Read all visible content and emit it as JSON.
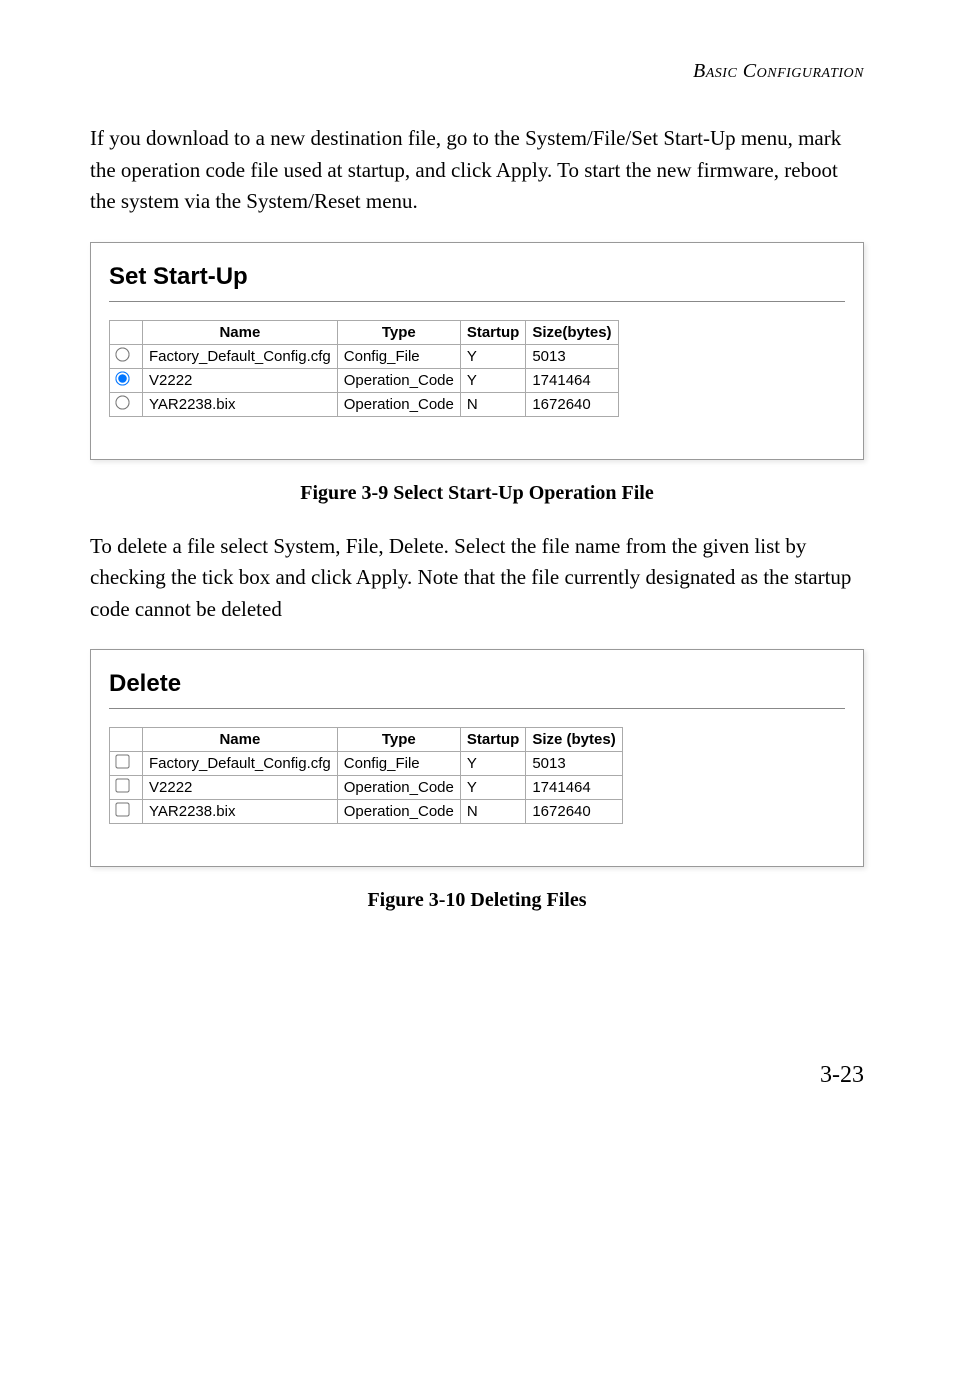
{
  "runningHeader": "Basic Configuration",
  "para1": "If you download to a new destination file, go to the System/File/Set Start-Up menu, mark the operation code file used at startup, and click Apply. To start the new firmware, reboot the system via the System/Reset menu.",
  "setStartUp": {
    "title": "Set Start-Up",
    "headers": {
      "name": "Name",
      "type": "Type",
      "startup": "Startup",
      "size": "Size(bytes)"
    },
    "rows": [
      {
        "selected": true,
        "name": "Factory_Default_Config.cfg",
        "type": "Config_File",
        "startup": "Y",
        "size": "5013"
      },
      {
        "selected": true,
        "name": "V2222",
        "type": "Operation_Code",
        "startup": "Y",
        "size": "1741464"
      },
      {
        "selected": false,
        "name": "YAR2238.bix",
        "type": "Operation_Code",
        "startup": "N",
        "size": "1672640"
      }
    ]
  },
  "caption1": "Figure 3-9  Select Start-Up Operation File",
  "para2": "To delete a file select System, File, Delete. Select the file name from the given list by checking the tick box and click Apply. Note that the file currently designated as the startup code cannot be deleted",
  "delete": {
    "title": "Delete",
    "headers": {
      "name": "Name",
      "type": "Type",
      "startup": "Startup",
      "size": "Size (bytes)"
    },
    "rows": [
      {
        "checked": false,
        "name": "Factory_Default_Config.cfg",
        "type": "Config_File",
        "startup": "Y",
        "size": "5013"
      },
      {
        "checked": false,
        "name": "V2222",
        "type": "Operation_Code",
        "startup": "Y",
        "size": "1741464"
      },
      {
        "checked": false,
        "name": "YAR2238.bix",
        "type": "Operation_Code",
        "startup": "N",
        "size": "1672640"
      }
    ]
  },
  "caption2": "Figure 3-10  Deleting Files",
  "pageNumber": "3-23"
}
